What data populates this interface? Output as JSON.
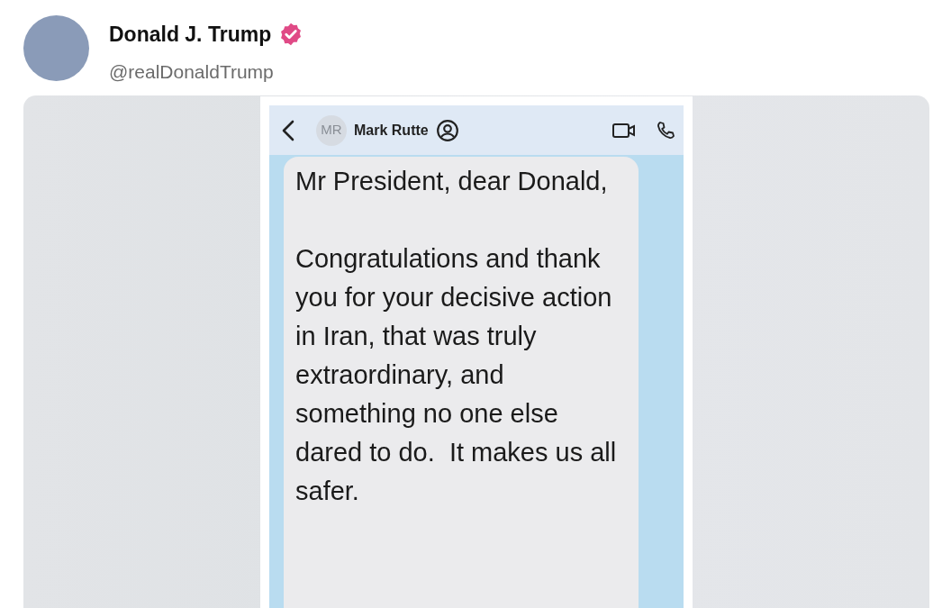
{
  "post": {
    "author": "Donald J. Trump",
    "verified": true,
    "handle": "@realDonaldTrump"
  },
  "chat": {
    "contact_initials": "MR",
    "contact_name": "Mark Rutte",
    "message_paragraphs": [
      "Mr President, dear Donald,",
      "Congratulations and thank you for your decisive action in Iran, that was truly extraordinary, and something no one else dared to do.  It makes us all safer."
    ]
  }
}
